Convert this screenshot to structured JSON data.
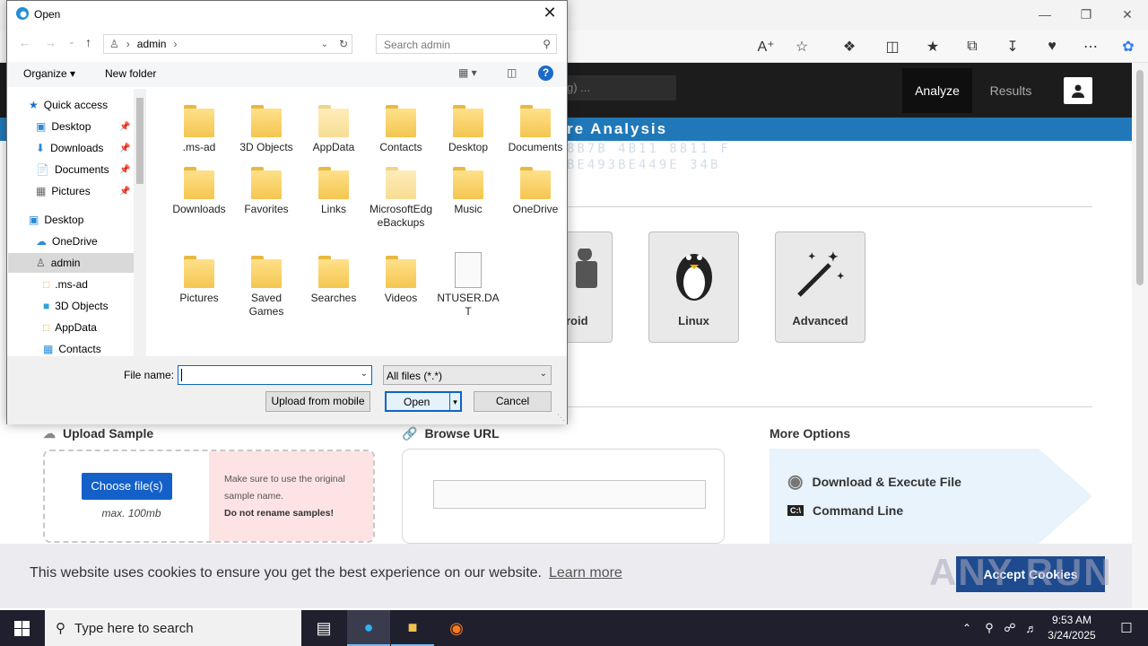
{
  "browser": {
    "toolbar_icons": [
      "read-aloud-icon",
      "favorite-star-icon",
      "extensions-icon",
      "split-screen-icon",
      "favorites-icon",
      "collections-icon",
      "downloads-icon",
      "performance-icon",
      "more-icon",
      "copilot-icon"
    ]
  },
  "site": {
    "search_placeholder": "g) ...",
    "nav": {
      "analyze": "Analyze",
      "results": "Results"
    },
    "hero_title": "re Analysis",
    "hex_lines": [
      "8B7B 4B11 8811 F",
      "BE493BE449E 34B"
    ],
    "os_cards": [
      {
        "label": "roid"
      },
      {
        "label": "Linux"
      },
      {
        "label": "Advanced"
      }
    ],
    "upload": {
      "title": "Upload Sample",
      "button": "Choose file(s)",
      "max": "max. 100mb",
      "note1": "Make sure to use the original sample name.",
      "note2": "Do not rename samples!"
    },
    "browse": {
      "title": "Browse URL"
    },
    "more": {
      "title": "More Options",
      "item1": "Download & Execute File",
      "item2": "Command Line"
    },
    "cookie": {
      "text": "This website uses cookies to ensure you get the best experience on our website.",
      "link": "Learn more",
      "accept": "Accept Cookies",
      "watermark": "ANY RUN"
    }
  },
  "dialog": {
    "title": "Open",
    "breadcrumb": "admin",
    "search_placeholder": "Search admin",
    "organize": "Organize",
    "new_folder": "New folder",
    "nav": [
      {
        "label": "Quick access"
      },
      {
        "label": "Desktop"
      },
      {
        "label": "Downloads"
      },
      {
        "label": "Documents"
      },
      {
        "label": "Pictures"
      },
      {
        "label": "Desktop"
      },
      {
        "label": "OneDrive"
      },
      {
        "label": "admin"
      },
      {
        "label": ".ms-ad"
      },
      {
        "label": "3D Objects"
      },
      {
        "label": "AppData"
      },
      {
        "label": "Contacts"
      }
    ],
    "files": [
      {
        "name": ".ms-ad"
      },
      {
        "name": "3D Objects"
      },
      {
        "name": "AppData"
      },
      {
        "name": "Contacts"
      },
      {
        "name": "Desktop"
      },
      {
        "name": "Documents"
      },
      {
        "name": "Downloads"
      },
      {
        "name": "Favorites"
      },
      {
        "name": "Links"
      },
      {
        "name": "MicrosoftEdgeBackups"
      },
      {
        "name": "Music"
      },
      {
        "name": "OneDrive"
      },
      {
        "name": "Pictures"
      },
      {
        "name": "Saved Games"
      },
      {
        "name": "Searches"
      },
      {
        "name": "Videos"
      },
      {
        "name": "NTUSER.DAT"
      }
    ],
    "file_name_label": "File name:",
    "file_name_value": "",
    "filter": "All files (*.*)",
    "upload_mobile": "Upload from mobile",
    "open": "Open",
    "cancel": "Cancel"
  },
  "taskbar": {
    "search_placeholder": "Type here to search",
    "time": "9:53 AM",
    "date": "3/24/2025"
  }
}
